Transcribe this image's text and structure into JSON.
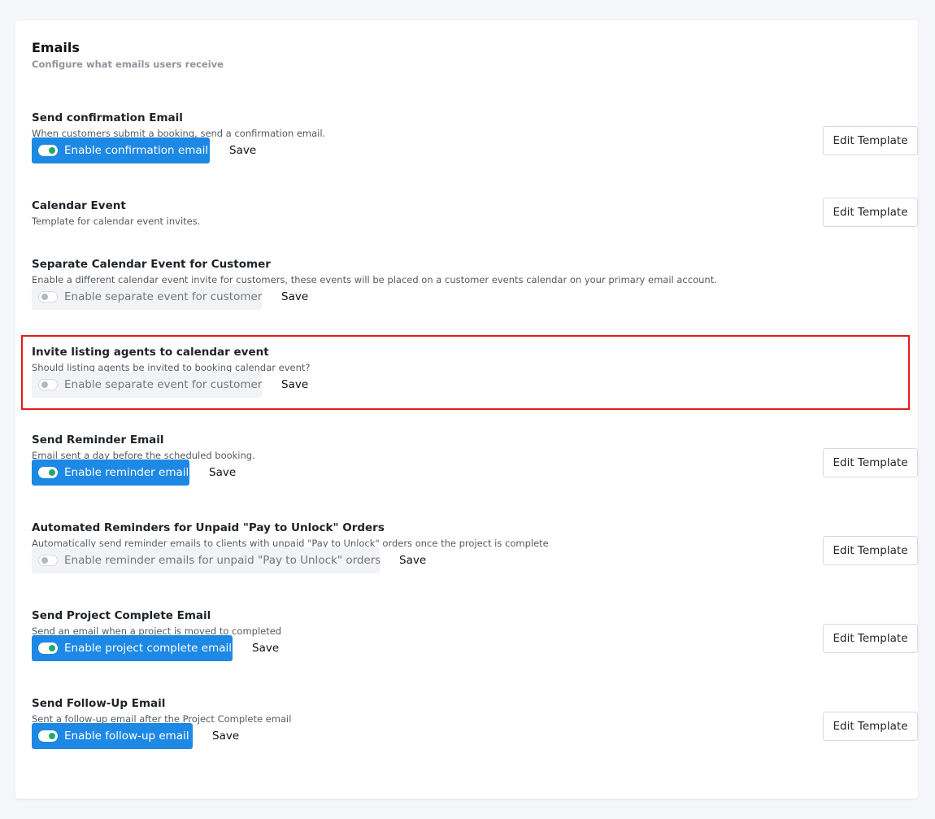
{
  "header": {
    "title": "Emails",
    "subtitle": "Configure what emails users receive"
  },
  "colors": {
    "accent": "#1e88e5",
    "toggle_on_knob": "#22a86b",
    "highlight_border": "#e51c1c"
  },
  "sections": [
    {
      "title": "Send confirmation Email",
      "description": "When customers submit a booking, send a confirmation email.",
      "toggle_label": "Enable confirmation email",
      "enabled": true,
      "save_label": "Save",
      "edit_label": "Edit Template"
    },
    {
      "title": "Calendar Event",
      "description": "Template for calendar event invites.",
      "edit_label": "Edit Template"
    },
    {
      "title": "Separate Calendar Event for Customer",
      "description": "Enable a different calendar event invite for customers, these events will be placed on a customer events calendar on your primary email account.",
      "toggle_label": "Enable separate event for customer",
      "enabled": false,
      "save_label": "Save"
    },
    {
      "title": "Invite listing agents to calendar event",
      "description": "Should listing agents be invited to booking calendar event?",
      "toggle_label": "Enable separate event for customer",
      "enabled": false,
      "save_label": "Save"
    },
    {
      "title": "Send Reminder Email",
      "description": "Email sent a day before the scheduled booking.",
      "toggle_label": "Enable reminder email",
      "enabled": true,
      "save_label": "Save",
      "edit_label": "Edit Template"
    },
    {
      "title": "Automated Reminders for Unpaid \"Pay to Unlock\" Orders",
      "description": "Automatically send reminder emails to clients with unpaid \"Pay to Unlock\" orders once the project is complete",
      "toggle_label": "Enable reminder emails for unpaid \"Pay to Unlock\" orders",
      "enabled": false,
      "save_label": "Save",
      "edit_label": "Edit Template"
    },
    {
      "title": "Send Project Complete Email",
      "description": "Send an email when a project is moved to completed",
      "toggle_label": "Enable project complete email",
      "enabled": true,
      "save_label": "Save",
      "edit_label": "Edit Template"
    },
    {
      "title": "Send Follow-Up Email",
      "description": "Sent a follow-up email after the Project Complete email",
      "toggle_label": "Enable follow-up email",
      "enabled": true,
      "save_label": "Save",
      "edit_label": "Edit Template"
    }
  ]
}
